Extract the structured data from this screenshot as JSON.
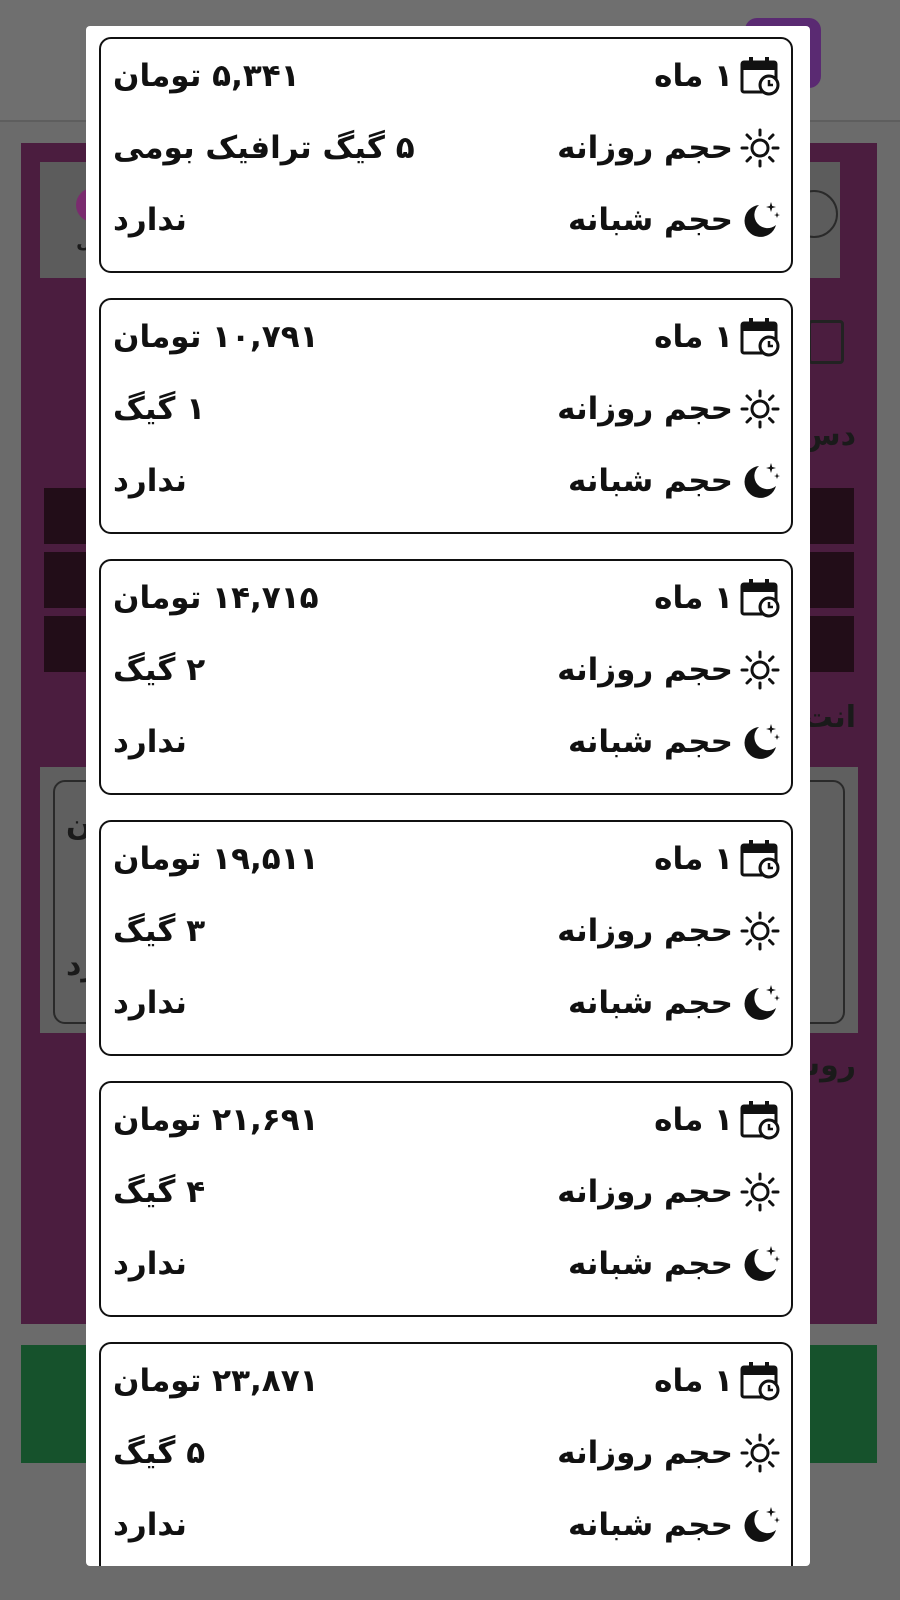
{
  "background_page": {
    "fragments": [
      "دس",
      "انت",
      "روش",
      "ل",
      "ن",
      "ل",
      "رد"
    ]
  },
  "modal": {
    "plans": [
      {
        "duration": "۱ ماه",
        "price": "۵,۳۴۱ تومان",
        "daily_label": "حجم روزانه",
        "daily_value": "۵ گیگ ترافیک بومی",
        "night_label": "حجم شبانه",
        "night_value": "ندارد"
      },
      {
        "duration": "۱ ماه",
        "price": "۱۰,۷۹۱ تومان",
        "daily_label": "حجم روزانه",
        "daily_value": "۱ گیگ",
        "night_label": "حجم شبانه",
        "night_value": "ندارد"
      },
      {
        "duration": "۱ ماه",
        "price": "۱۴,۷۱۵ تومان",
        "daily_label": "حجم روزانه",
        "daily_value": "۲ گیگ",
        "night_label": "حجم شبانه",
        "night_value": "ندارد"
      },
      {
        "duration": "۱ ماه",
        "price": "۱۹,۵۱۱ تومان",
        "daily_label": "حجم روزانه",
        "daily_value": "۳ گیگ",
        "night_label": "حجم شبانه",
        "night_value": "ندارد"
      },
      {
        "duration": "۱ ماه",
        "price": "۲۱,۶۹۱ تومان",
        "daily_label": "حجم روزانه",
        "daily_value": "۴ گیگ",
        "night_label": "حجم شبانه",
        "night_value": "ندارد"
      },
      {
        "duration": "۱ ماه",
        "price": "۲۳,۸۷۱ تومان",
        "daily_label": "حجم روزانه",
        "daily_value": "۵ گیگ",
        "night_label": "حجم شبانه",
        "night_value": "ندارد"
      }
    ],
    "icons": {
      "duration": "calendar-clock-icon",
      "daily": "sun-icon",
      "night": "moon-stars-icon"
    }
  },
  "colors": {
    "overlay": "#6b6b6b",
    "panel": "#4b1d3f",
    "accent_purple": "#5a2a72",
    "button_green": "#16522c",
    "card_border": "#111111"
  }
}
